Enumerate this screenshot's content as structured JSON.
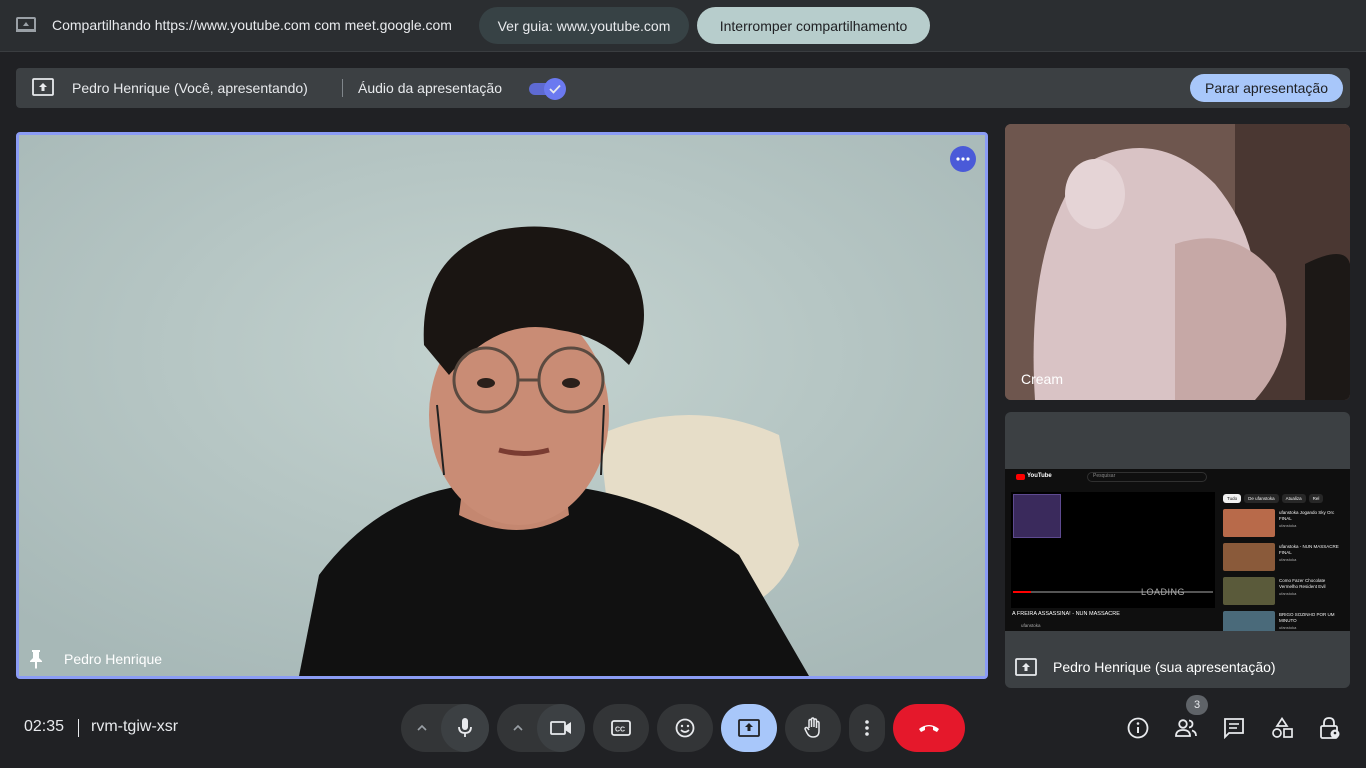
{
  "share_bar": {
    "text": "Compartilhando https://www.youtube.com com meet.google.com",
    "guide_button": "Ver guia: www.youtube.com",
    "stop_button": "Interromper compartilhamento"
  },
  "presentation_bar": {
    "presenter": "Pedro Henrique (Você, apresentando)",
    "audio_label": "Áudio da apresentação",
    "audio_enabled": true,
    "stop_button": "Parar apresentação"
  },
  "main_tile": {
    "name": "Pedro Henrique"
  },
  "side_tiles": {
    "cream": {
      "name": "Cream"
    },
    "presentation": {
      "name": "Pedro Henrique (sua apresentação)",
      "preview": {
        "logo": "YouTube",
        "search_placeholder": "Pesquisar",
        "loading": "LOADING",
        "video_title": "A FREIRA ASSASSINA! - NUN MASSACRE",
        "channel": "ufanstoka",
        "chips": [
          "Tudo",
          "De ufanstoka",
          "Atualiza",
          "Rel"
        ],
        "related": [
          {
            "title": "ufanstoka Jogando Sky Orc FINAL",
            "meta": "ufanstoka"
          },
          {
            "title": "ufanstoka - NUN MASSACRE FINAL",
            "meta": "ufanstoka"
          },
          {
            "title": "Como Fazer Chocolate Vermelho Resident Evil",
            "meta": "ufanstoka"
          },
          {
            "title": "BRIGO SOZINHO POR UM MINUTO",
            "meta": "ufanstoka"
          }
        ]
      }
    }
  },
  "bottom_bar": {
    "time": "02:35",
    "meeting_code": "rvm-tgiw-xsr",
    "participants_count": "3"
  },
  "colors": {
    "accent": "#a8c7fa",
    "end_call": "#e5182b",
    "tile_border": "#8b9cf5",
    "background": "#202124"
  }
}
